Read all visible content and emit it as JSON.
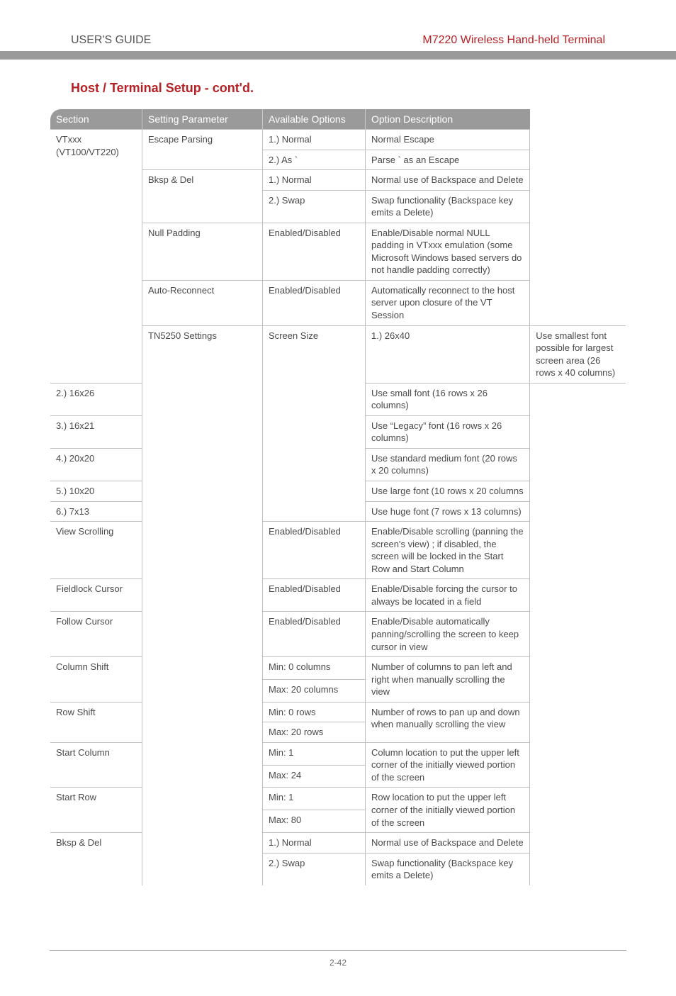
{
  "header": {
    "left": "USER'S GUIDE",
    "right": "M7220 Wireless Hand-held Terminal"
  },
  "section_title": "Host / Terminal Setup - cont'd.",
  "table": {
    "headers": [
      "Section",
      "Setting Parameter",
      "Available Options",
      "Option Description"
    ],
    "rows": [
      {
        "section": "VTxxx (VT100/VT220)",
        "section_rowspan": 7,
        "param": "Escape Parsing",
        "param_rowspan": 2,
        "option": "1.) Normal",
        "desc": "Normal Escape"
      },
      {
        "option": "2.) As `",
        "desc": "Parse ` as an Escape"
      },
      {
        "param": "Bksp & Del",
        "param_rowspan": 2,
        "option": "1.) Normal",
        "desc": "Normal use of Backspace and Delete"
      },
      {
        "option": "2.) Swap",
        "desc": "Swap functionality (Backspace key emits a Delete)"
      },
      {
        "param": "Null Padding",
        "option": "Enabled/Disabled",
        "desc": "Enable/Disable normal NULL padding in VTxxx emulation (some Microsoft Windows based servers do not handle padding correctly)"
      },
      {
        "param": "Auto-Reconnect",
        "option": "Enabled/Disabled",
        "desc": "Automatically reconnect to the host server upon closure of the VT Session"
      },
      {
        "section": "TN5250 Settings",
        "section_rowspan": 19,
        "param": "Screen Size",
        "param_rowspan": 6,
        "option": "1.) 26x40",
        "desc": "Use smallest font possible for largest screen area (26 rows x 40 columns)"
      },
      {
        "option": "2.) 16x26",
        "desc": "Use small font (16 rows x 26 columns)"
      },
      {
        "option": "3.) 16x21",
        "desc": "Use “Legacy” font (16 rows x 26 columns)"
      },
      {
        "option": "4.) 20x20",
        "desc": "Use standard medium font (20 rows x 20 columns)"
      },
      {
        "option": "5.) 10x20",
        "desc": "Use large font (10 rows x 20 columns"
      },
      {
        "option": "6.) 7x13",
        "desc": "Use huge font (7 rows x 13 columns)"
      },
      {
        "param": "View Scrolling",
        "option": "Enabled/Disabled",
        "desc": "Enable/Disable scrolling (panning the screen's view) ; if disabled, the screen will be locked in the Start Row and Start Column"
      },
      {
        "param": "Fieldlock Cursor",
        "option": "Enabled/Disabled",
        "desc": "Enable/Disable forcing the cursor to always be located in a field"
      },
      {
        "param": "Follow Cursor",
        "option": "Enabled/Disabled",
        "desc": "Enable/Disable automatically panning/scrolling the screen to keep cursor in view"
      },
      {
        "param": "Column Shift",
        "param_rowspan": 2,
        "option": "Min: 0 columns",
        "desc": "Number of columns to pan left and right when manually scrolling the view",
        "desc_rowspan": 2
      },
      {
        "option": "Max: 20 columns"
      },
      {
        "param": "Row Shift",
        "param_rowspan": 2,
        "option": "Min: 0 rows",
        "desc": "Number of rows to pan up and down when manually scrolling the view",
        "desc_rowspan": 2
      },
      {
        "option": "Max: 20 rows"
      },
      {
        "param": "Start Column",
        "param_rowspan": 2,
        "option": "Min: 1",
        "desc": "Column location to put the upper left corner of the initially viewed portion of the screen",
        "desc_rowspan": 2
      },
      {
        "option": "Max: 24"
      },
      {
        "param": "Start Row",
        "param_rowspan": 2,
        "option": "Min: 1",
        "desc": "Row location to put the upper left corner of the initially viewed portion of the screen",
        "desc_rowspan": 2
      },
      {
        "option": "Max: 80"
      },
      {
        "param": "Bksp & Del",
        "param_rowspan": 2,
        "option": "1.) Normal",
        "desc": "Normal use of Backspace and Delete"
      },
      {
        "option": "2.) Swap",
        "desc": "Swap functionality (Backspace key emits a Delete)"
      }
    ]
  },
  "page_number": "2-42"
}
